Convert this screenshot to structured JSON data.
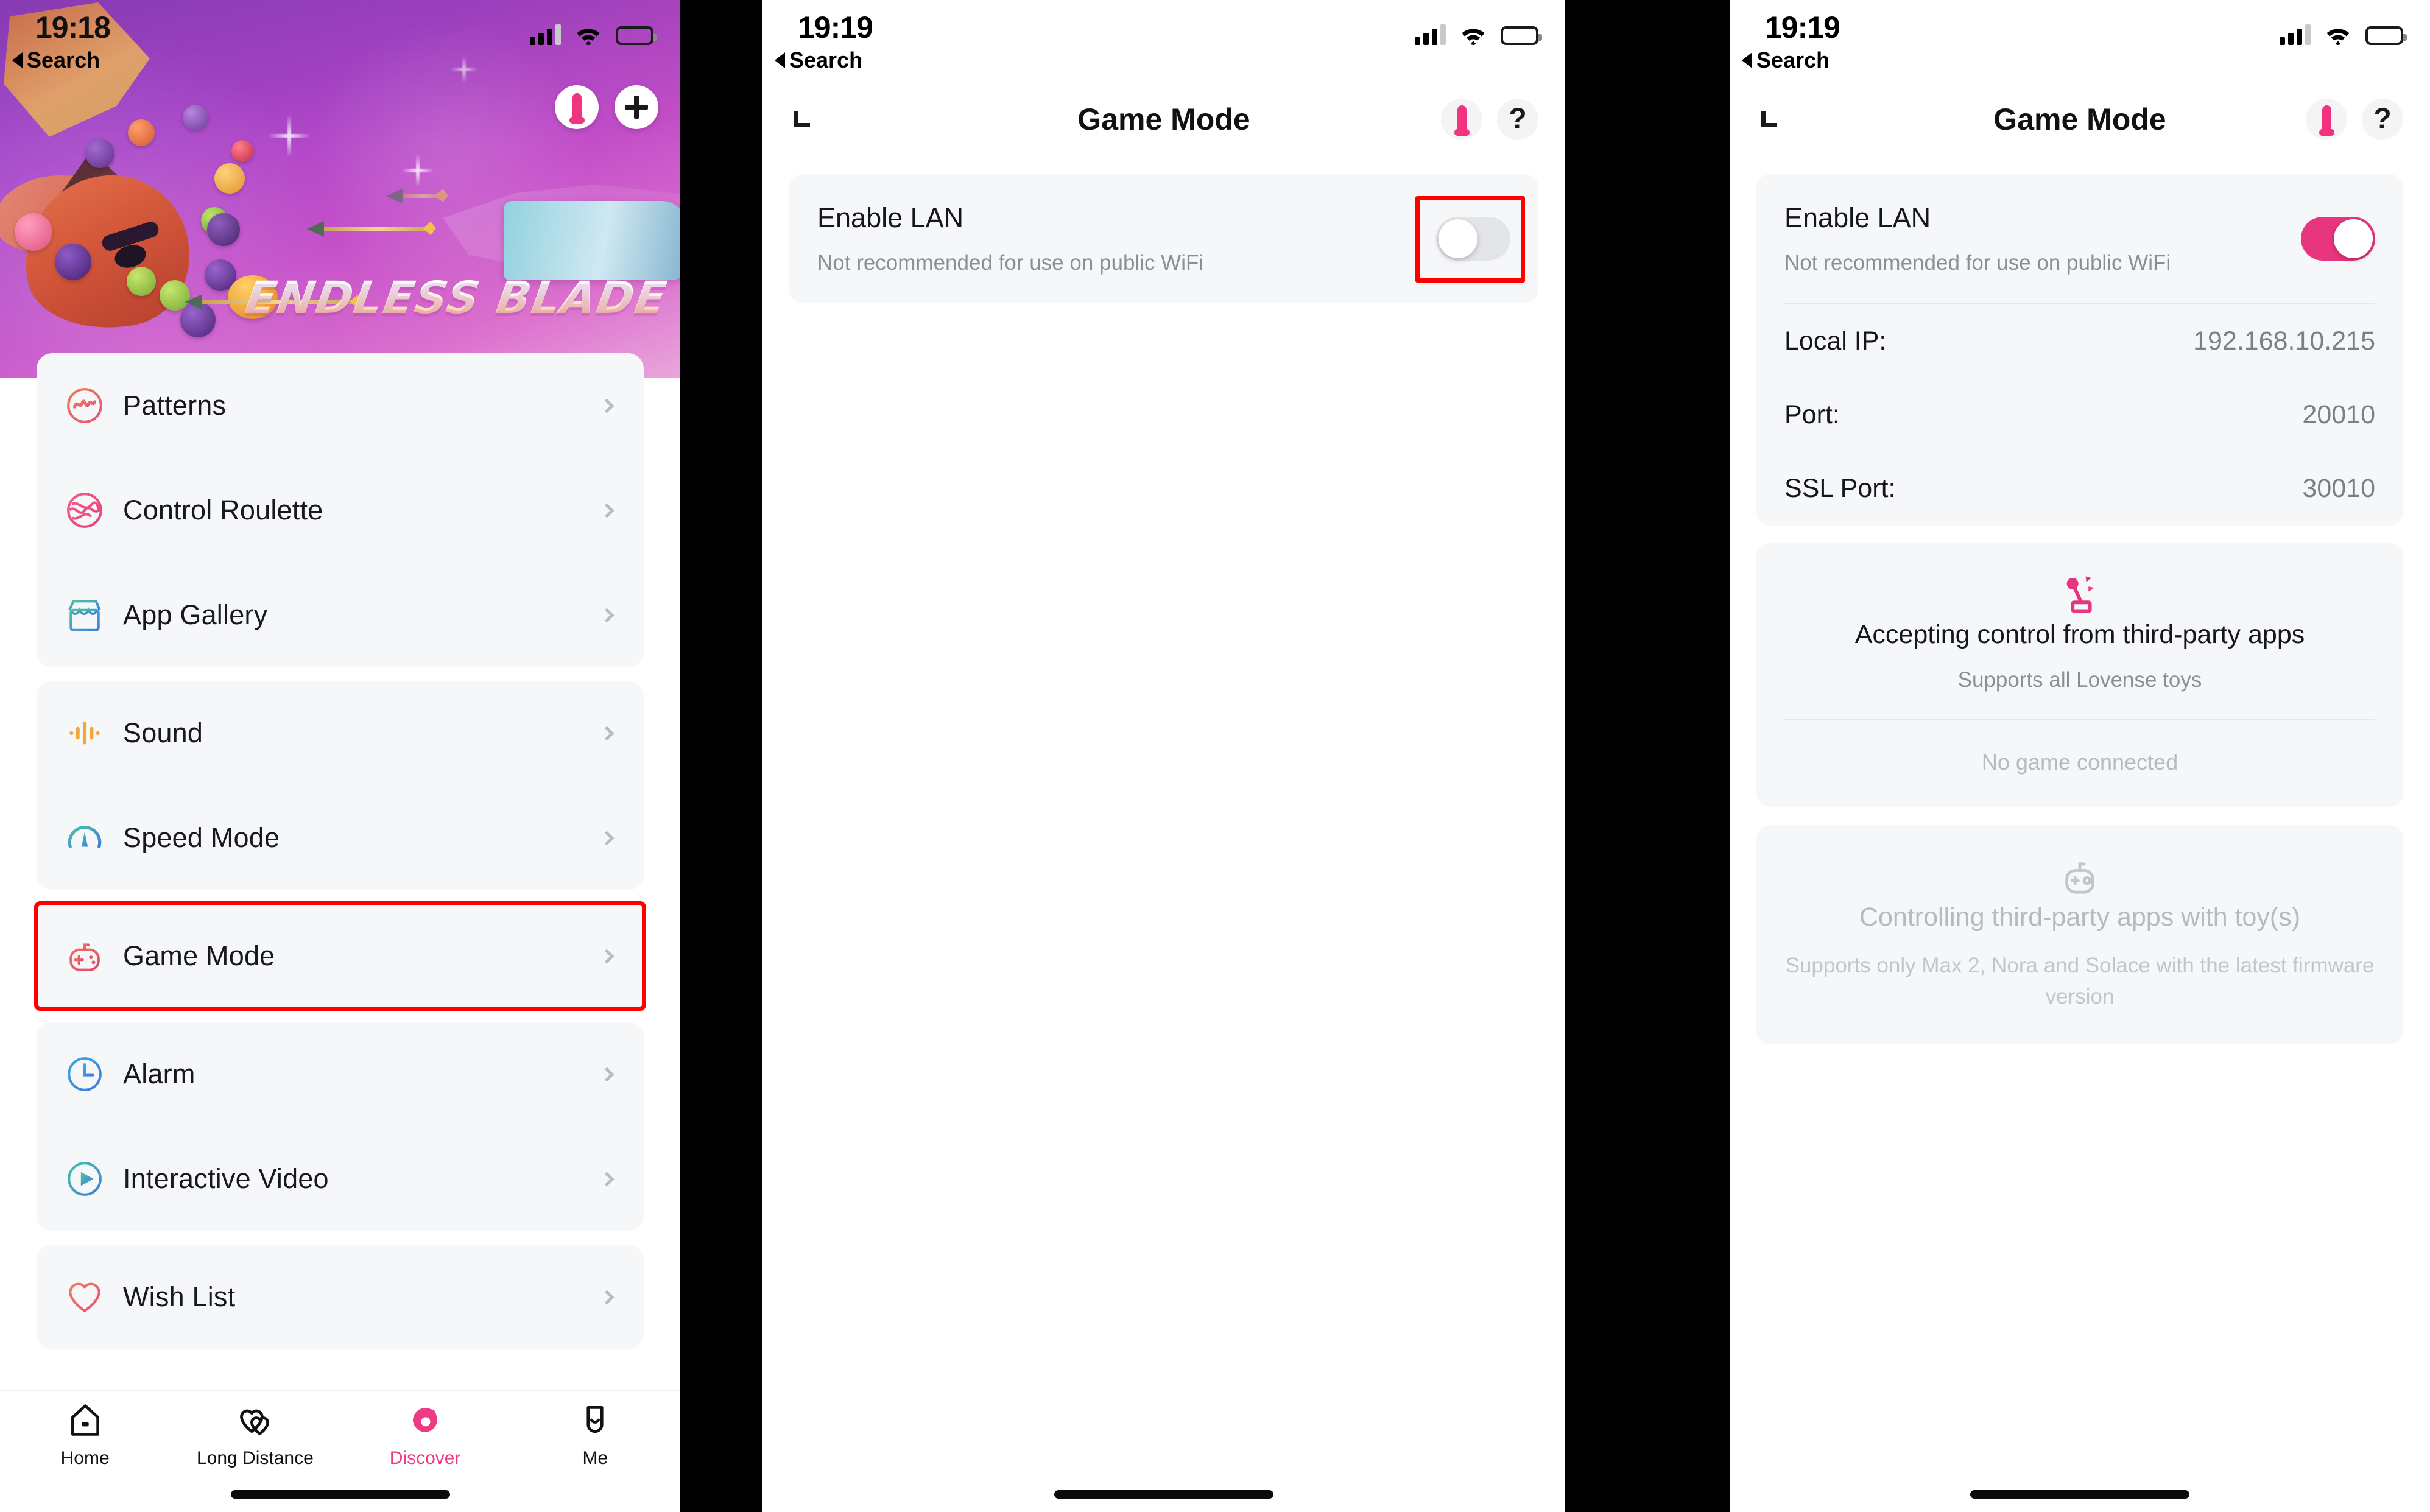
{
  "panels": {
    "left": {
      "status": {
        "time": "19:18",
        "back_label": "Search"
      },
      "hero": {
        "game_title": "ENDLESS BLADE",
        "toy_button": "toy-icon",
        "add_button": "plus-icon"
      },
      "groups": [
        {
          "items": [
            {
              "label": "Patterns",
              "icon": "patterns-icon"
            },
            {
              "label": "Control Roulette",
              "icon": "roulette-icon"
            },
            {
              "label": "App Gallery",
              "icon": "store-icon"
            }
          ]
        },
        {
          "items": [
            {
              "label": "Sound",
              "icon": "sound-wave-icon"
            },
            {
              "label": "Speed Mode",
              "icon": "speedometer-icon"
            }
          ]
        },
        {
          "highlighted": true,
          "items": [
            {
              "label": "Game Mode",
              "icon": "gamepad-icon"
            }
          ]
        },
        {
          "items": [
            {
              "label": "Alarm",
              "icon": "clock-icon"
            },
            {
              "label": "Interactive Video",
              "icon": "play-circle-icon"
            }
          ]
        },
        {
          "items": [
            {
              "label": "Wish List",
              "icon": "heart-icon"
            }
          ]
        }
      ],
      "tabs": [
        {
          "label": "Home",
          "icon": "home-icon",
          "active": false
        },
        {
          "label": "Long Distance",
          "icon": "two-hearts-icon",
          "active": false
        },
        {
          "label": "Discover",
          "icon": "discover-icon",
          "active": true
        },
        {
          "label": "Me",
          "icon": "profile-icon",
          "active": false
        }
      ]
    },
    "middle": {
      "status": {
        "time": "19:19",
        "back_label": "Search"
      },
      "nav": {
        "title": "Game Mode",
        "back_icon": "chevron-left-icon",
        "toy_icon": "toy-icon",
        "help_label": "?"
      },
      "lan": {
        "title": "Enable LAN",
        "subtitle": "Not recommended for use on public WiFi",
        "enabled": false,
        "highlighted": true
      }
    },
    "right": {
      "status": {
        "time": "19:19",
        "back_label": "Search"
      },
      "nav": {
        "title": "Game Mode",
        "back_icon": "chevron-left-icon",
        "toy_icon": "toy-icon",
        "help_label": "?"
      },
      "lan": {
        "title": "Enable LAN",
        "subtitle": "Not recommended for use on public WiFi",
        "enabled": true,
        "highlighted": false
      },
      "network": [
        {
          "key": "Local IP:",
          "value": "192.168.10.215"
        },
        {
          "key": "Port:",
          "value": "20010"
        },
        {
          "key": "SSL Port:",
          "value": "30010"
        }
      ],
      "cards": [
        {
          "icon": "joystick-icon",
          "title": "Accepting control from third-party apps",
          "subtitle": "Supports all Lovense toys",
          "status": "No game connected",
          "dim": false
        },
        {
          "icon": "gamepad-icon",
          "title": "Controlling third-party apps with toy(s)",
          "subtitle": "Supports only Max 2, Nora and Solace with the latest firmware version",
          "status": "",
          "dim": true
        }
      ]
    }
  },
  "colors": {
    "accent_pink": "#e8357f",
    "highlight_red": "#fe0000",
    "card_bg": "#f6f7f9",
    "muted_text": "#8b8e96"
  }
}
